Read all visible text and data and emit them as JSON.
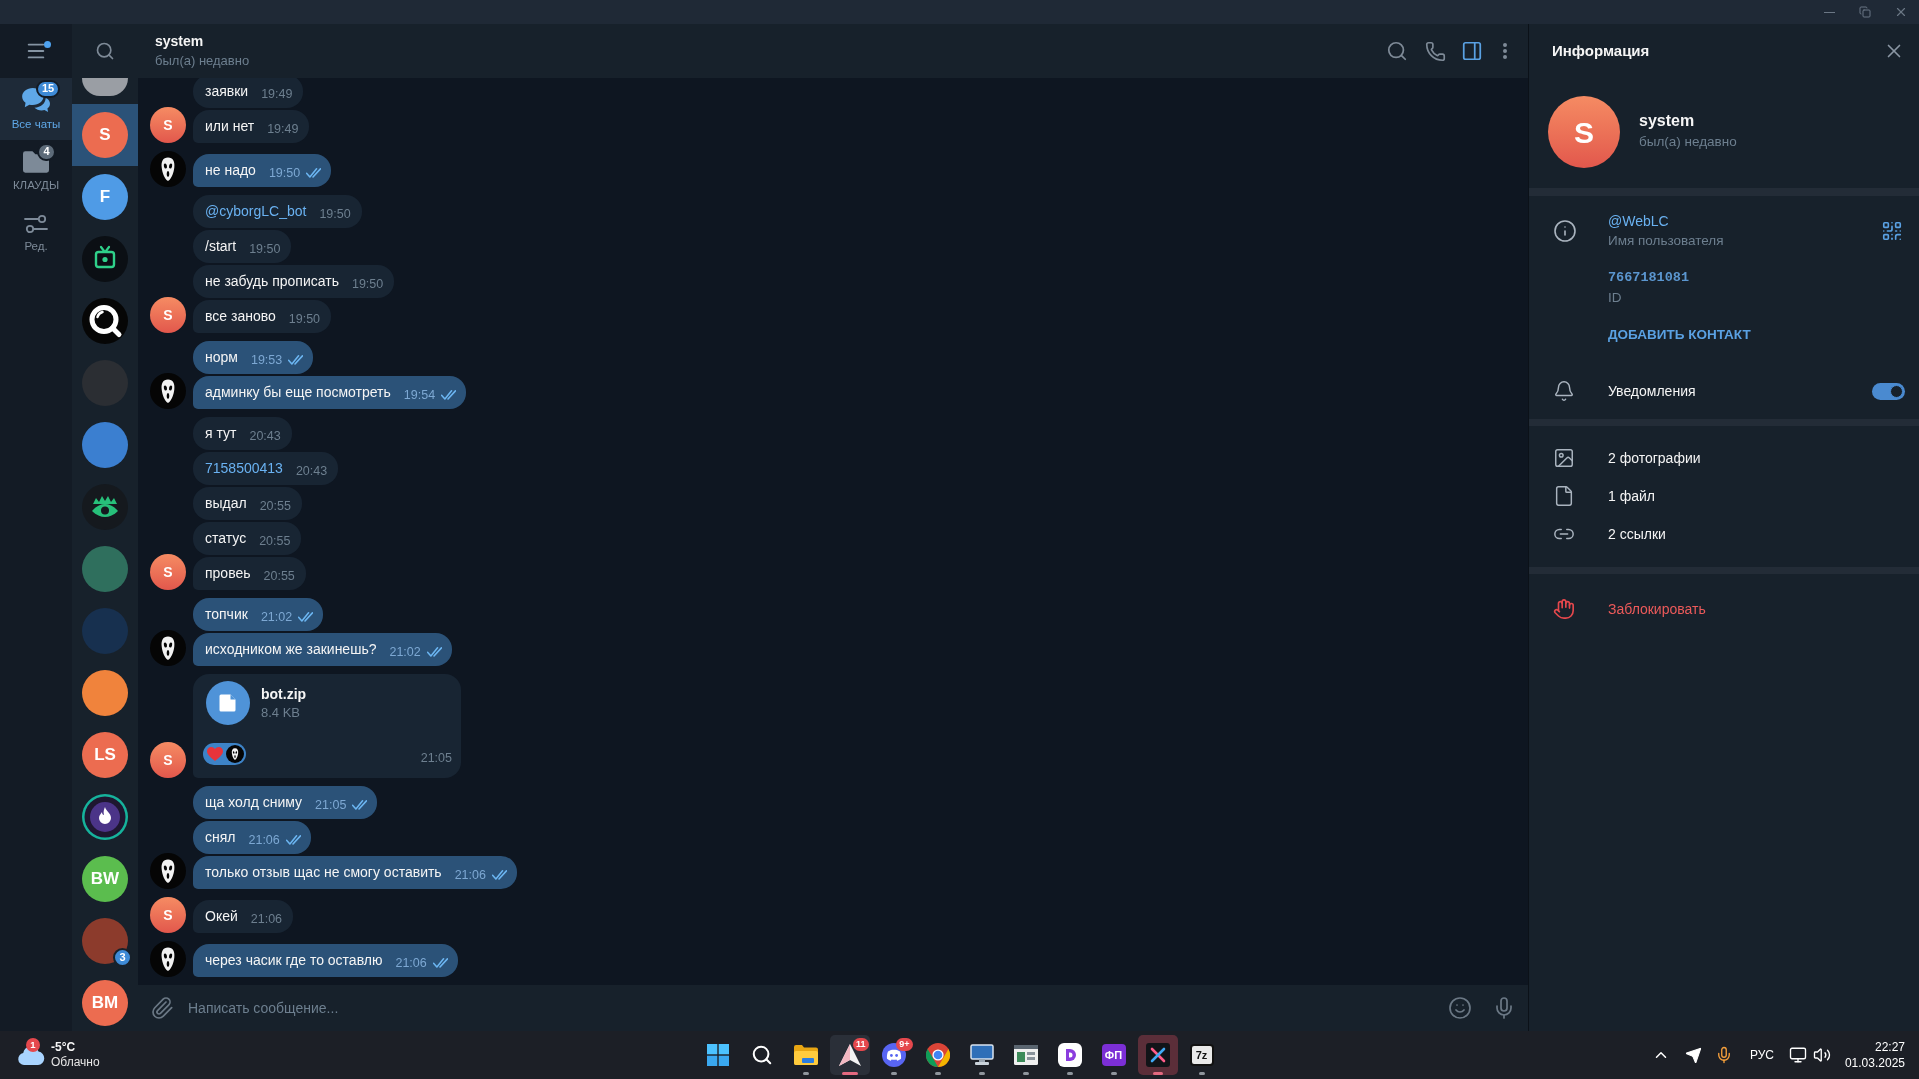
{
  "menu": {
    "notification": true
  },
  "folders": [
    {
      "kind": "chats",
      "label": "Все чаты",
      "badge": "15",
      "selected": true
    },
    {
      "kind": "folder",
      "label": "КЛАУДЫ",
      "badge": "4",
      "selected": false
    },
    {
      "kind": "edit",
      "label": "Ред.",
      "selected": false
    }
  ],
  "chat_list": [
    {
      "kind": "partial",
      "color": "#9a9ea4",
      "selected": false
    },
    {
      "kind": "letter",
      "avatar": "S",
      "color": "#ec6c50",
      "selected": true
    },
    {
      "kind": "letter",
      "avatar": "F",
      "color": "#4f9be6",
      "selected": false
    },
    {
      "kind": "tv",
      "selected": false
    },
    {
      "kind": "ring",
      "selected": false
    },
    {
      "kind": "photo",
      "color": "#2b2e33",
      "selected": false
    },
    {
      "kind": "photo",
      "color": "#3b7fd0",
      "selected": false
    },
    {
      "kind": "eye",
      "selected": false
    },
    {
      "kind": "photo",
      "color": "#2f6f5d",
      "selected": false
    },
    {
      "kind": "photo",
      "color": "#17304f",
      "selected": false
    },
    {
      "kind": "photo",
      "color": "#f0833c",
      "selected": false
    },
    {
      "kind": "letter",
      "avatar": "LS",
      "color": "#ec6c50",
      "selected": false
    },
    {
      "kind": "flame",
      "selected": false
    },
    {
      "kind": "letter",
      "avatar": "BW",
      "color": "#5bbd4e",
      "selected": false
    },
    {
      "kind": "photo",
      "color": "#8c3b2c",
      "badge": "3",
      "selected": false
    },
    {
      "kind": "letter",
      "avatar": "BM",
      "color": "#ec6c50",
      "selected": false
    }
  ],
  "chat": {
    "title": "system",
    "status": "был(а) недавно",
    "info_panel_open": true
  },
  "message_groups": [
    {
      "kind": "incoming",
      "avatar": "S",
      "messages": [
        {
          "kind": "text",
          "text": "заявки",
          "time": "19:49"
        },
        {
          "kind": "text",
          "text": "или нет",
          "time": "19:49"
        }
      ]
    },
    {
      "kind": "outgoing",
      "messages": [
        {
          "kind": "text",
          "text": "не надо",
          "time": "19:50",
          "read": true
        }
      ]
    },
    {
      "kind": "incoming",
      "avatar": "S",
      "messages": [
        {
          "kind": "link",
          "text": "@cyborgLC_bot",
          "time": "19:50"
        },
        {
          "kind": "text",
          "text": "/start",
          "time": "19:50"
        },
        {
          "kind": "text",
          "text": "не забудь прописать",
          "time": "19:50"
        },
        {
          "kind": "text",
          "text": "все заново",
          "time": "19:50"
        }
      ]
    },
    {
      "kind": "outgoing",
      "messages": [
        {
          "kind": "text",
          "text": "норм",
          "time": "19:53",
          "read": true
        },
        {
          "kind": "text",
          "text": "админку бы еще посмотреть",
          "time": "19:54",
          "read": true
        }
      ]
    },
    {
      "kind": "incoming",
      "avatar": "S",
      "messages": [
        {
          "kind": "text",
          "text": "я тут",
          "time": "20:43"
        },
        {
          "kind": "link",
          "text": "7158500413",
          "time": "20:43"
        },
        {
          "kind": "text",
          "text": "выдал",
          "time": "20:55"
        },
        {
          "kind": "text",
          "text": "статус",
          "time": "20:55"
        },
        {
          "kind": "text",
          "text": "провеь",
          "time": "20:55"
        }
      ]
    },
    {
      "kind": "outgoing",
      "messages": [
        {
          "kind": "text",
          "text": "топчик",
          "time": "21:02",
          "read": true
        },
        {
          "kind": "text",
          "text": "исходником же закинешь?",
          "time": "21:02",
          "read": true
        }
      ]
    },
    {
      "kind": "incoming",
      "avatar": "S",
      "messages": [
        {
          "kind": "file",
          "name": "bot.zip",
          "size": "8.4 KB",
          "time": "21:05",
          "reactions": [
            {
              "kind": "heart",
              "selected": true
            }
          ]
        }
      ]
    },
    {
      "kind": "outgoing",
      "messages": [
        {
          "kind": "text",
          "text": "ща холд сниму",
          "time": "21:05",
          "read": true
        },
        {
          "kind": "text",
          "text": "снял",
          "time": "21:06",
          "read": true
        },
        {
          "kind": "text",
          "text": "только отзыв щас не смогу оставить",
          "time": "21:06",
          "read": true
        }
      ]
    },
    {
      "kind": "incoming",
      "avatar": "S",
      "messages": [
        {
          "kind": "text",
          "text": "Окей",
          "time": "21:06"
        }
      ]
    },
    {
      "kind": "outgoing",
      "messages": [
        {
          "kind": "text",
          "text": "через часик где то оставлю",
          "time": "21:06",
          "read": true
        }
      ]
    }
  ],
  "composer": {
    "placeholder": "Написать сообщение..."
  },
  "info_panel": {
    "title": "Информация",
    "avatar": "S",
    "name": "system",
    "status": "был(а) недавно",
    "username": "@WebLC",
    "username_label": "Имя пользователя",
    "id": "7667181081",
    "id_label": "ID",
    "add_contact": "ДОБАВИТЬ КОНТАКТ",
    "notifications": {
      "label": "Уведомления",
      "on": true
    },
    "media": [
      {
        "kind": "photos",
        "label": "2 фотографии"
      },
      {
        "kind": "files",
        "label": "1 файл"
      },
      {
        "kind": "links",
        "label": "2 ссылки"
      }
    ],
    "block": "Заблокировать"
  },
  "taskbar": {
    "weather": {
      "badge": "1",
      "temperature": "-5°C",
      "condition": "Облачно"
    },
    "apps": [
      {
        "kind": "start",
        "running": false,
        "selected": false,
        "attention": false
      },
      {
        "kind": "search",
        "running": false,
        "selected": false,
        "attention": false
      },
      {
        "kind": "explorer",
        "running": true,
        "selected": false,
        "attention": false
      },
      {
        "kind": "telegram",
        "badge": "11",
        "running": true,
        "selected": true,
        "attention": false
      },
      {
        "kind": "discord",
        "badge": "9+",
        "running": true,
        "selected": false,
        "attention": false
      },
      {
        "kind": "chrome",
        "running": true,
        "selected": false,
        "attention": false
      },
      {
        "kind": "computer",
        "running": true,
        "selected": false,
        "attention": false
      },
      {
        "kind": "window",
        "running": true,
        "selected": false,
        "attention": false
      },
      {
        "kind": "dlogo",
        "running": true,
        "selected": false,
        "attention": false
      },
      {
        "kind": "lettertile",
        "label": "ФП",
        "color": "#7c2fd6",
        "running": true,
        "selected": false,
        "attention": false
      },
      {
        "kind": "terminal",
        "running": true,
        "selected": false,
        "attention": true
      },
      {
        "kind": "lettertile",
        "label": "7z",
        "color": "#e9e9e9",
        "running": true,
        "selected": false,
        "attention": false
      }
    ],
    "tray": {
      "mic_in_use": true,
      "language": "РУС",
      "time": "22:27",
      "date": "01.03.2025"
    }
  }
}
